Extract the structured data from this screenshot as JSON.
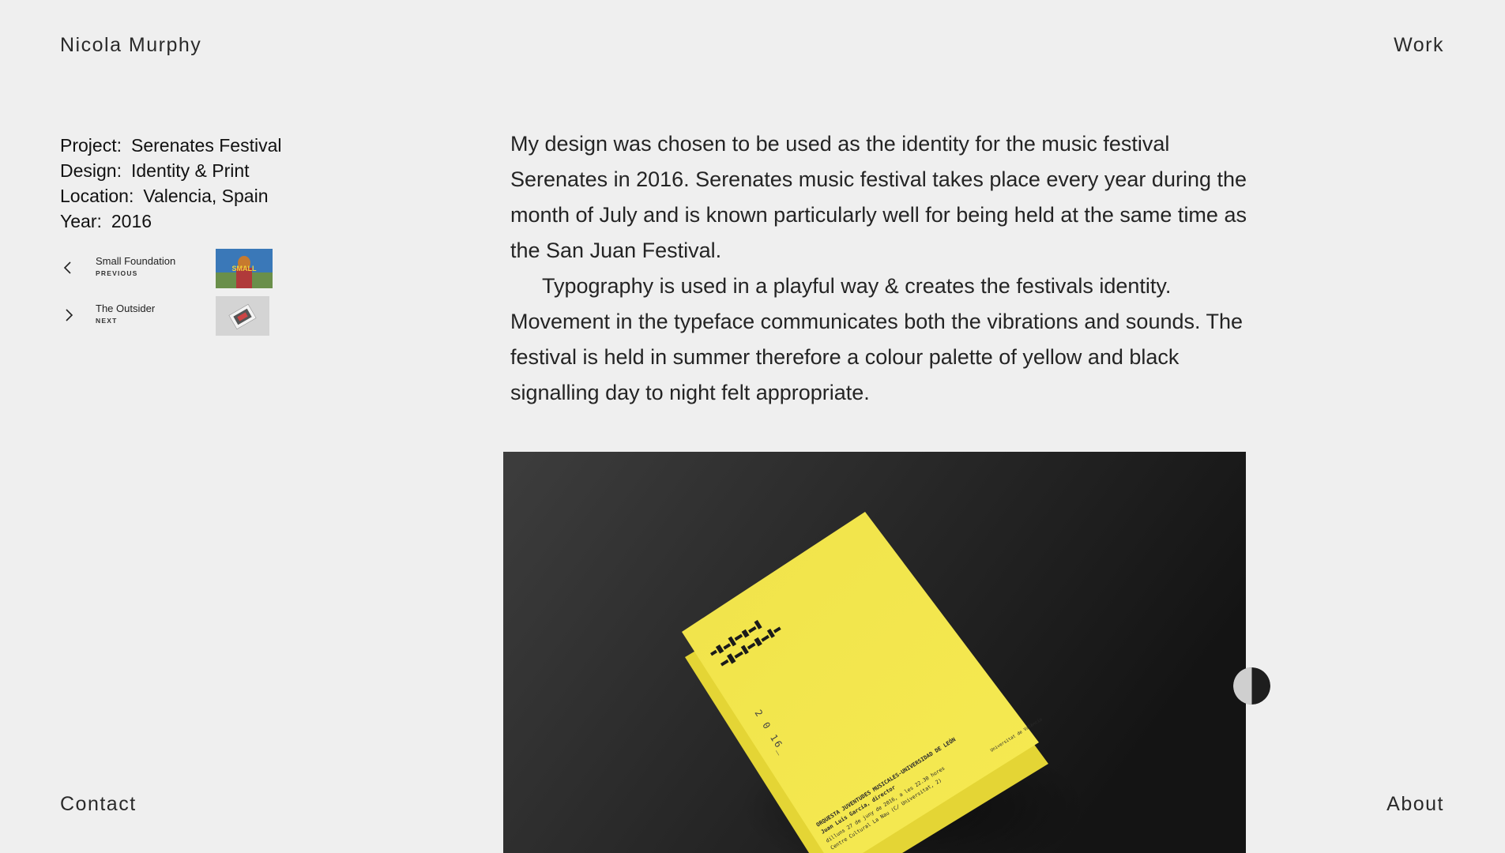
{
  "header": {
    "site_name": "Nicola Murphy",
    "nav_work": "Work"
  },
  "footer": {
    "nav_contact": "Contact",
    "nav_about": "About"
  },
  "project": {
    "meta": [
      {
        "key": "Project:",
        "value": "Serenates Festival"
      },
      {
        "key": "Design:",
        "value": "Identity & Print"
      },
      {
        "key": "Location:",
        "value": "Valencia, Spain"
      },
      {
        "key": "Year:",
        "value": "2016"
      }
    ],
    "previous": {
      "title": "Small Foundation",
      "label": "PREVIOUS",
      "thumb_text": "SMALL"
    },
    "next": {
      "title": "The Outsider",
      "label": "NEXT"
    }
  },
  "description": {
    "paragraphs": [
      "My design was chosen to be used as the identity for the music festival Serenates in 2016. Serenates music festival takes place every year during the month of July and is known particularly well for being held at the same time as the San Juan Festival.",
      "Typography is used in a playful way & creates the festivals identity. Movement in the typeface communicates both the vibrations and sounds. The festival is held in summer therefore a colour palette of yellow and black signalling day to night felt appropriate."
    ]
  },
  "hero": {
    "brochure_year": "2 0 16_",
    "brochure_line1": "ORQUESTA JUVENTUDES MUSICALES-UNIVERSIDAD DE LEÓN",
    "brochure_line2": "Juan Luis García, director",
    "brochure_line3": "dilluns 27 de juny de 2016, a les 22.30 hores",
    "brochure_line4": "Centre Cultural La Nau (C/ Universitat, 2)",
    "brochure_logo": "Universitat de València"
  },
  "colors": {
    "background": "#efefef",
    "text": "#1c1c1c",
    "accent_yellow": "#f3e53f",
    "hero_dark": "#2b2b2b"
  }
}
